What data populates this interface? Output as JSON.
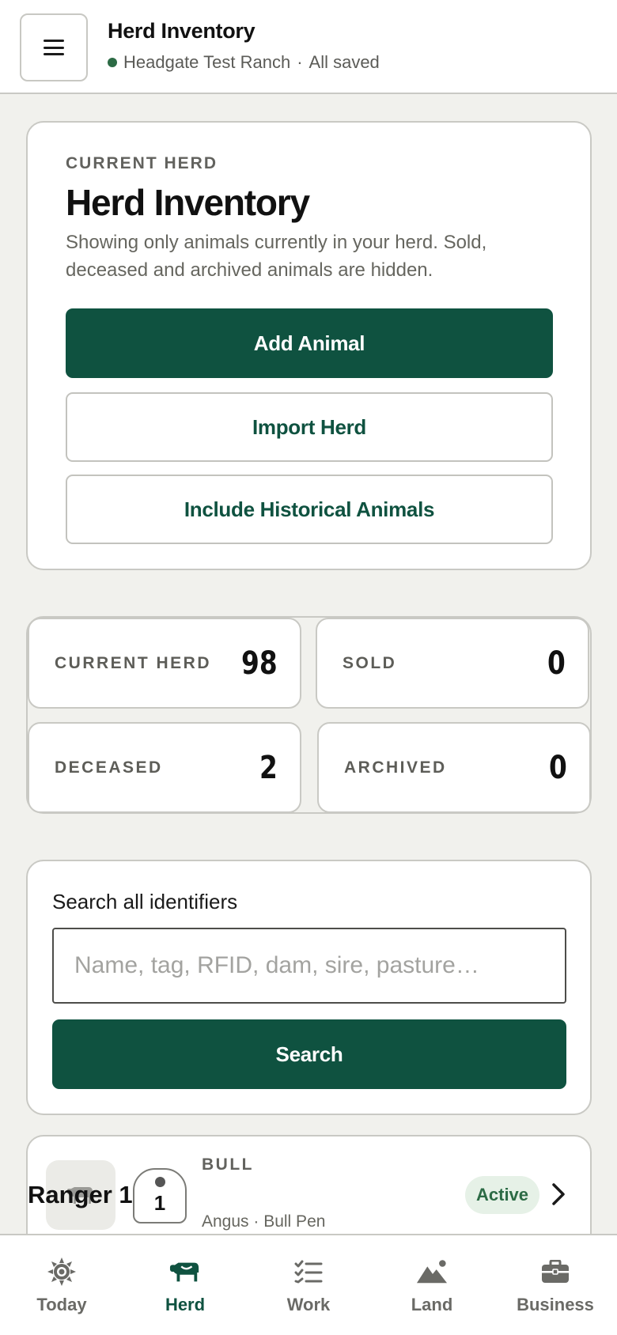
{
  "header": {
    "title": "Herd Inventory",
    "ranch": "Headgate Test Ranch",
    "separator": "·",
    "save_status": "All saved",
    "status_color": "#2c6b45"
  },
  "hero": {
    "eyebrow": "CURRENT HERD",
    "title": "Herd Inventory",
    "description": "Showing only animals currently in your herd. Sold, deceased and archived animals are hidden.",
    "add_label": "Add Animal",
    "import_label": "Import Herd",
    "historical_label": "Include Historical Animals"
  },
  "stats": [
    {
      "label": "CURRENT HERD",
      "value": "98"
    },
    {
      "label": "SOLD",
      "value": "0"
    },
    {
      "label": "DECEASED",
      "value": "2"
    },
    {
      "label": "ARCHIVED",
      "value": "0"
    }
  ],
  "search": {
    "label": "Search all identifiers",
    "placeholder": "Name, tag, RFID, dam, sire, pasture…",
    "value": "",
    "button_label": "Search"
  },
  "animals": [
    {
      "kind": "BULL",
      "tag": "1",
      "name": "Ranger 1",
      "meta": "Angus · Bull Pen",
      "status": "Active"
    }
  ],
  "tabs": [
    {
      "label": "Today",
      "icon": "sun-icon",
      "active": false
    },
    {
      "label": "Herd",
      "icon": "cow-icon",
      "active": true
    },
    {
      "label": "Work",
      "icon": "checklist-icon",
      "active": false
    },
    {
      "label": "Land",
      "icon": "mountain-icon",
      "active": false
    },
    {
      "label": "Business",
      "icon": "briefcase-icon",
      "active": false
    }
  ],
  "colors": {
    "brand": "#0f5240",
    "background": "#f1f1ed",
    "active_badge_bg": "#e6f1e7"
  }
}
